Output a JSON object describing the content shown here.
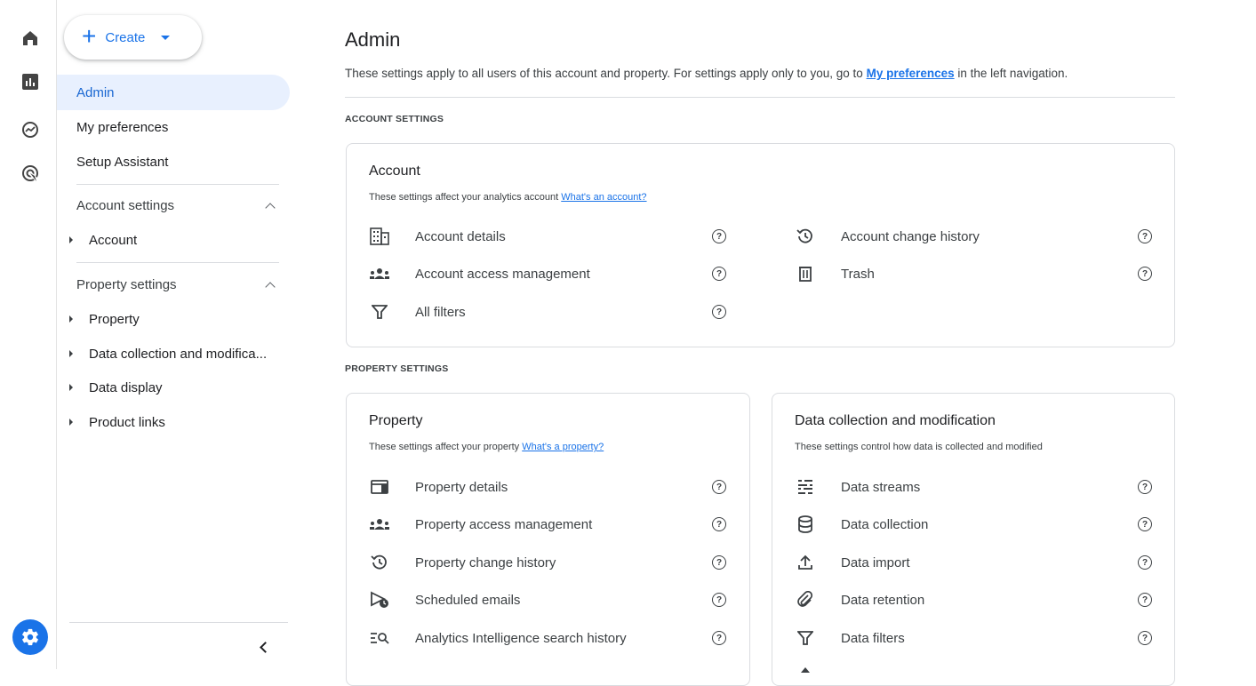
{
  "rail": {
    "icons": [
      "home-icon",
      "reports-icon",
      "explore-icon",
      "advertising-icon"
    ],
    "admin_icon": "settings-gear-icon"
  },
  "sidenav": {
    "create_label": "Create",
    "items": [
      {
        "label": "Admin",
        "active": true
      },
      {
        "label": "My preferences"
      },
      {
        "label": "Setup Assistant"
      }
    ],
    "account_section": {
      "label": "Account settings",
      "children": [
        "Account"
      ]
    },
    "property_section": {
      "label": "Property settings",
      "children": [
        "Property",
        "Data collection and modifica...",
        "Data display",
        "Product links"
      ]
    }
  },
  "main": {
    "title": "Admin",
    "desc_before": "These settings apply to all users of this account and property. For settings apply only to you, go to ",
    "desc_link": "My preferences",
    "desc_after": " in the left navigation.",
    "account_caption": "ACCOUNT SETTINGS",
    "property_caption": "PROPERTY SETTINGS",
    "account_card": {
      "title": "Account",
      "sub": "These settings affect your analytics account ",
      "sub_link": "What's an account?",
      "left": [
        "Account details",
        "Account access management",
        "All filters"
      ],
      "right": [
        "Account change history",
        "Trash"
      ]
    },
    "property_card": {
      "title": "Property",
      "sub": "These settings affect your property ",
      "sub_link": "What's a property?",
      "items": [
        "Property details",
        "Property access management",
        "Property change history",
        "Scheduled emails",
        "Analytics Intelligence search history"
      ]
    },
    "data_card": {
      "title": "Data collection and modification",
      "sub": "These settings control how data is collected and modified",
      "items": [
        "Data streams",
        "Data collection",
        "Data import",
        "Data retention",
        "Data filters"
      ]
    },
    "help_glyph": "?"
  }
}
